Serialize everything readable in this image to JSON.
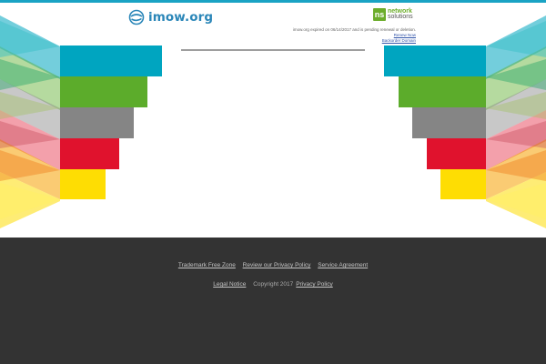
{
  "header": {
    "logo_text": "imow.org",
    "partner_logo": {
      "mark": "ns",
      "line1": "network",
      "line2": "solutions"
    }
  },
  "notice": {
    "message": "imow.org expired on 06/14/2017 and is pending renewal or deletion.",
    "links": [
      "Renew Now",
      "Backorder Domain"
    ]
  },
  "footer": {
    "row1": [
      "Trademark Free Zone",
      "Review our Privacy Policy",
      "Service Agreement"
    ],
    "row2": {
      "legal_notice": "Legal Notice",
      "copyright": "Copyright 2017",
      "privacy": "Privacy Policy"
    }
  },
  "colors": {
    "accent": "#1aa3c4",
    "blue": "#00a5c0",
    "green": "#5cac2b",
    "gray": "#858585",
    "red": "#e0122d",
    "yellow": "#fedd03",
    "footer_bg": "#333333"
  },
  "icons": {
    "site_logo": "globe-swirl-icon"
  }
}
